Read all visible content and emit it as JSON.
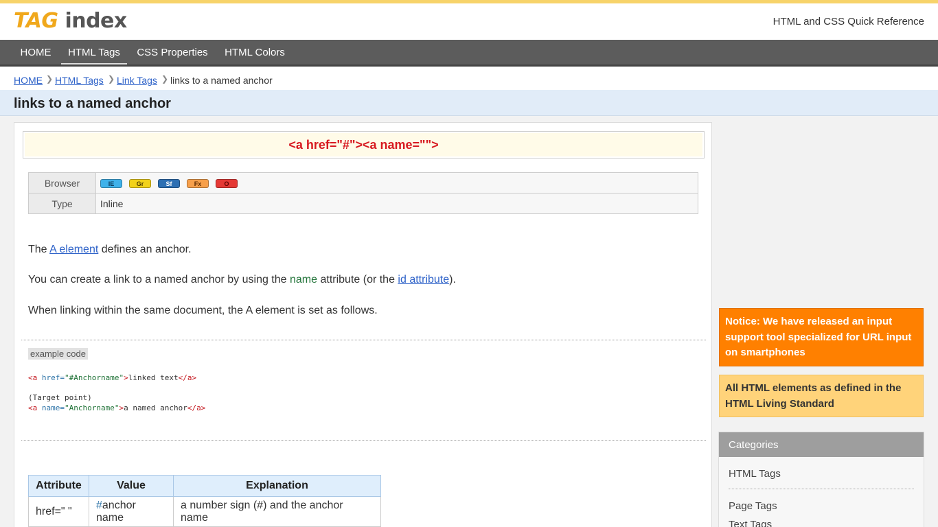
{
  "header": {
    "logo_tag": "TAG",
    "logo_index": "index",
    "tagline": "HTML and CSS Quick Reference"
  },
  "nav": {
    "items": [
      "HOME",
      "HTML Tags",
      "CSS Properties",
      "HTML Colors"
    ],
    "active": "HTML Tags"
  },
  "breadcrumb": {
    "links": [
      "HOME",
      "HTML Tags",
      "Link Tags"
    ],
    "current": "links to a named anchor"
  },
  "page_title": "links to a named anchor",
  "tag_syntax": "<a href=\"#\"><a name=\"\">",
  "info": {
    "browser_label": "Browser",
    "browsers": [
      {
        "label": "IE",
        "color": "#3fb2ea"
      },
      {
        "label": "Gr",
        "color": "#f2d21b"
      },
      {
        "label": "Sf",
        "color": "#2d6fb3"
      },
      {
        "label": "Fx",
        "color": "#f7a04b"
      },
      {
        "label": "O",
        "color": "#e53935"
      }
    ],
    "type_label": "Type",
    "type_value": "Inline"
  },
  "content": {
    "p1_prefix": "The ",
    "p1_link": "A element",
    "p1_suffix": " defines an anchor.",
    "p2_prefix": "You can create a link to a named anchor by using the ",
    "p2_attr": "name",
    "p2_middle": " attribute (or the ",
    "p2_link": "id attribute",
    "p2_suffix": ").",
    "p3": "When linking within the same document, the A element is set as follows."
  },
  "example": {
    "label": "example code",
    "line1_href_value": "#Anchorname",
    "line1_text": "linked text",
    "line2": "(Target point)",
    "line3_name_value": "Anchorname",
    "line3_text": "a named anchor"
  },
  "attr_table": {
    "headers": [
      "Attribute",
      "Value",
      "Explanation"
    ],
    "row1": {
      "attribute": "href=\" \"",
      "value_hash": "#",
      "value_rest": "anchor name",
      "explanation": "a number sign (#) and the anchor name"
    }
  },
  "sidebar": {
    "notice1": "Notice: We have released an input support tool specialized for URL input on smartphones",
    "notice2": "All HTML elements as defined in the HTML Living Standard",
    "categories_title": "Categories",
    "categories": [
      "HTML Tags",
      "Page Tags",
      "Text Tags"
    ]
  }
}
